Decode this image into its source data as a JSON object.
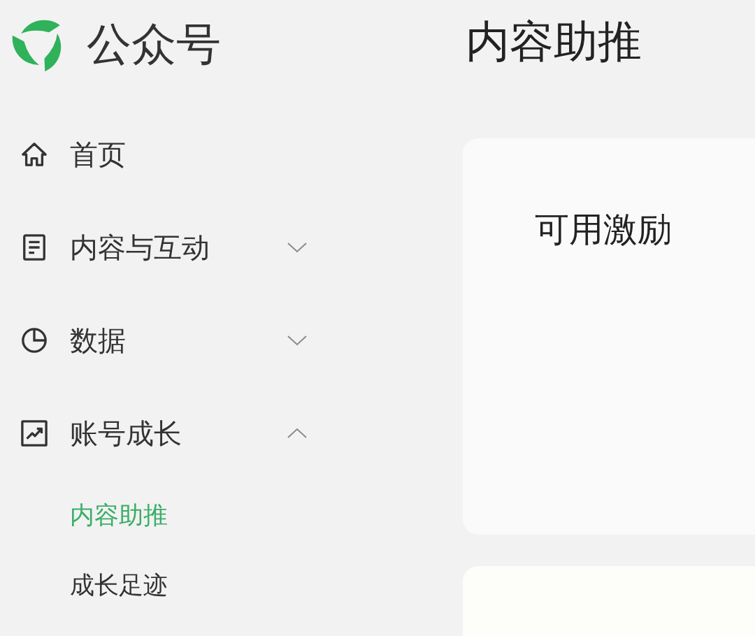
{
  "app": {
    "name": "公众号"
  },
  "sidebar": {
    "items": [
      {
        "kind": "link",
        "label": "首页"
      },
      {
        "kind": "group",
        "label": "内容与互动",
        "expanded": false
      },
      {
        "kind": "group",
        "label": "数据",
        "expanded": false
      },
      {
        "kind": "group",
        "label": "账号成长",
        "expanded": true,
        "children": [
          {
            "label": "内容助推",
            "selected": true
          },
          {
            "label": "成长足迹",
            "selected": false
          }
        ]
      }
    ]
  },
  "page": {
    "title": "内容助推",
    "cards": [
      {
        "title": "可用激励"
      }
    ]
  }
}
